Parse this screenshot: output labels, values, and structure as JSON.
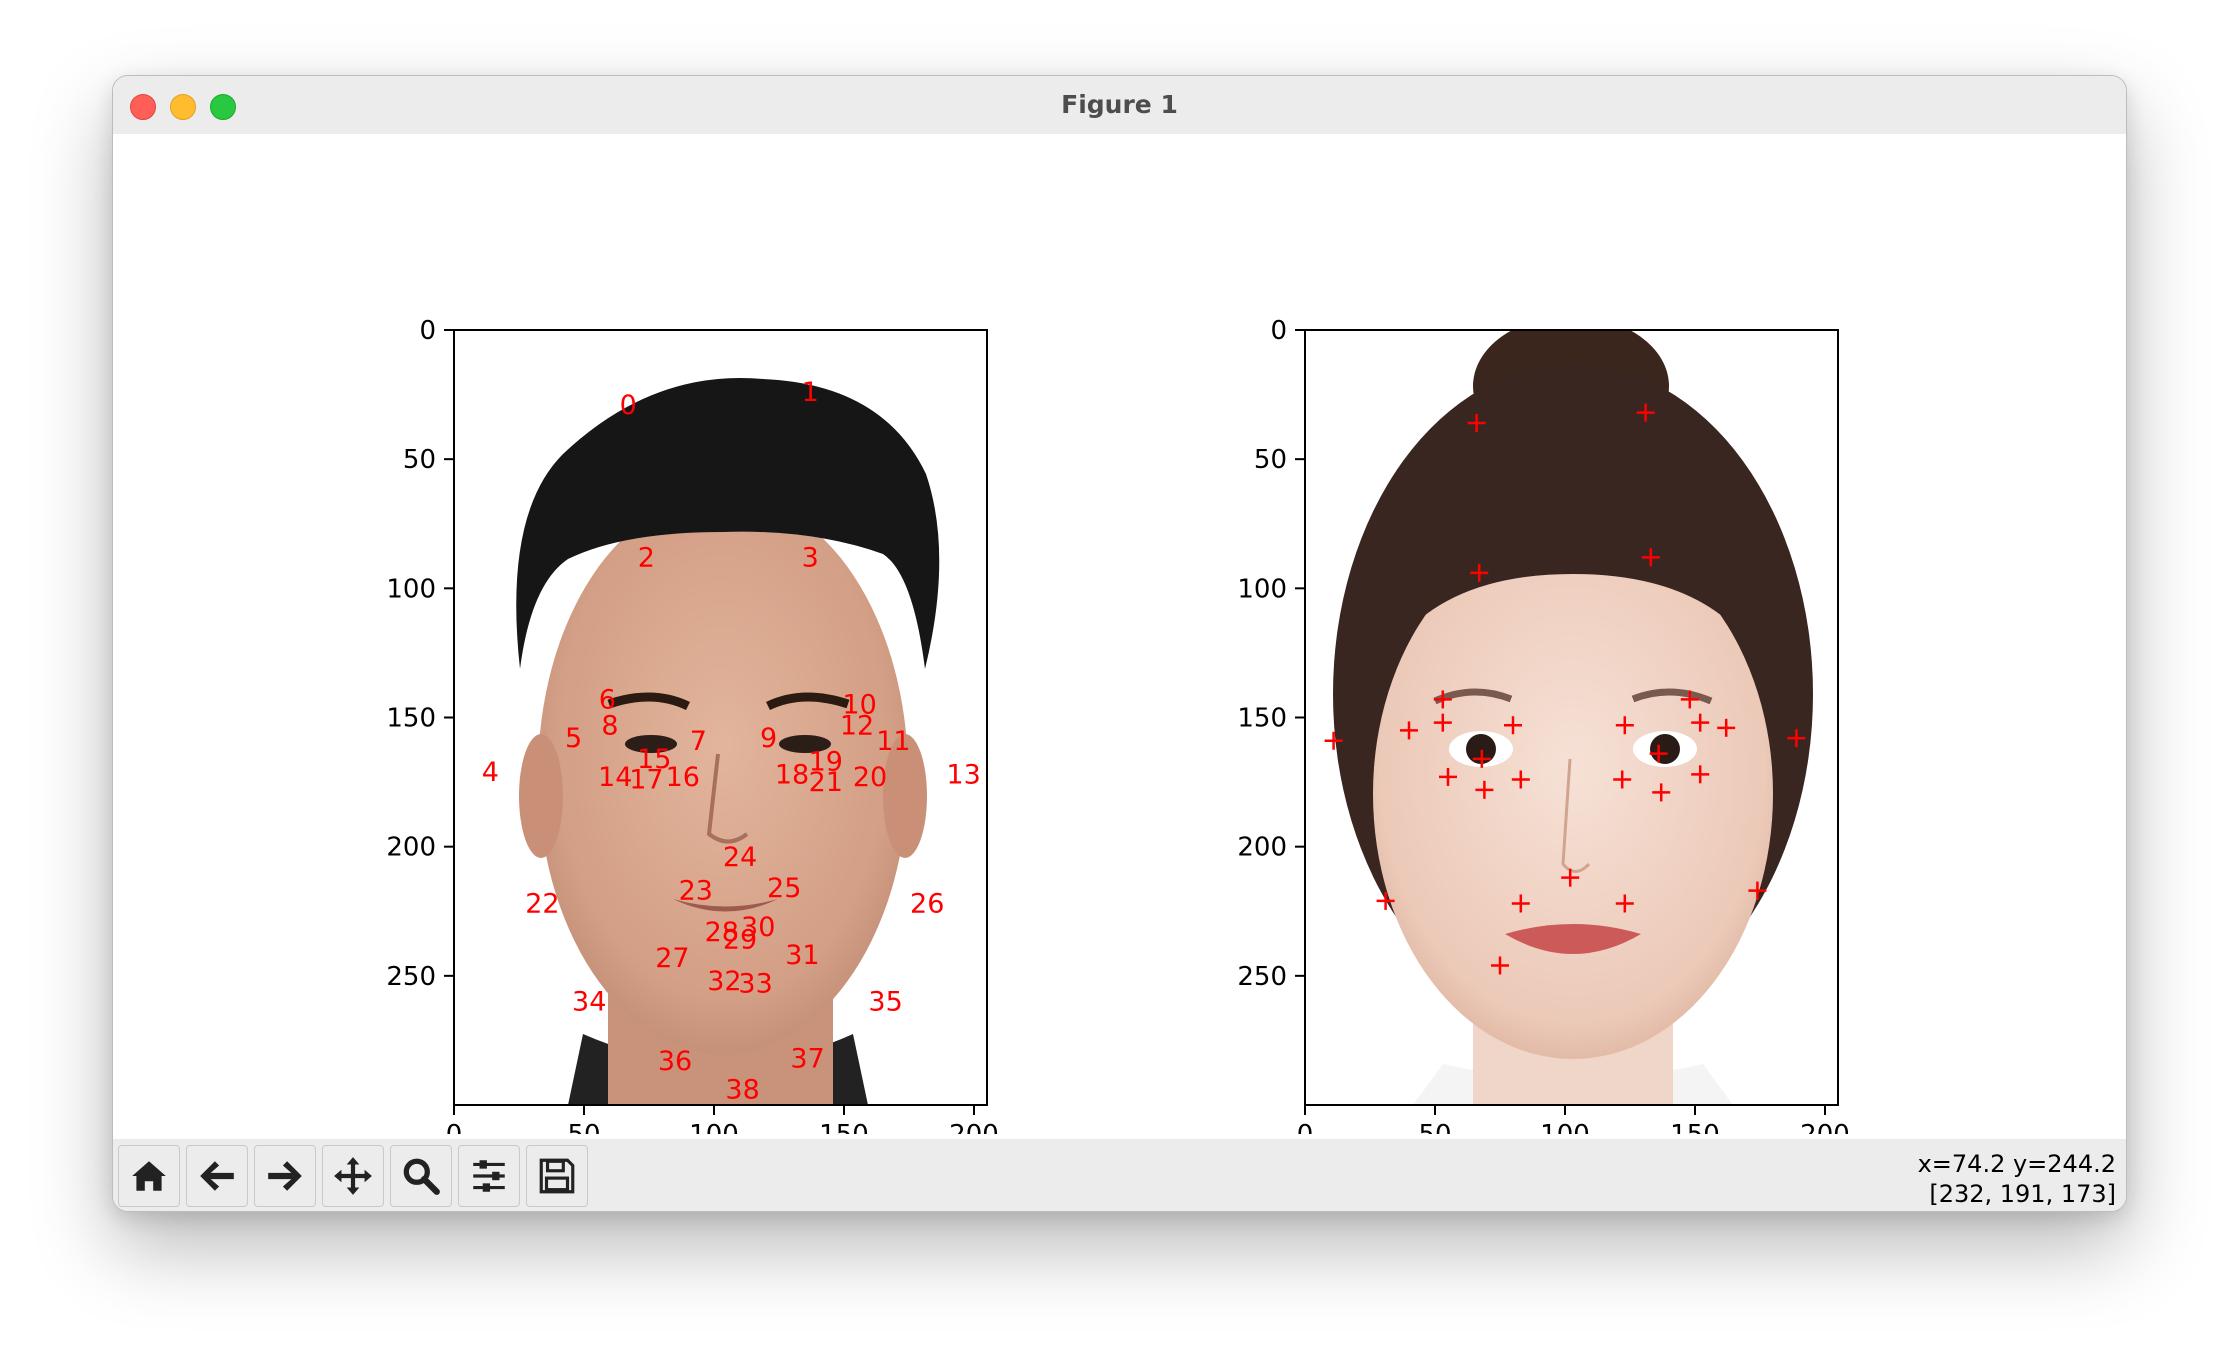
{
  "window": {
    "title": "Figure 1"
  },
  "toolbar": {
    "buttons": [
      {
        "name": "home-button",
        "icon": "home-icon"
      },
      {
        "name": "back-button",
        "icon": "arrow-left-icon"
      },
      {
        "name": "forward-button",
        "icon": "arrow-right-icon"
      },
      {
        "name": "pan-button",
        "icon": "move-icon"
      },
      {
        "name": "zoom-button",
        "icon": "magnifier-icon"
      },
      {
        "name": "configure-subplots-button",
        "icon": "sliders-icon"
      },
      {
        "name": "save-button",
        "icon": "floppy-disk-icon"
      }
    ]
  },
  "status": {
    "coords": "x=74.2 y=244.2",
    "pixel": "[232, 191, 173]"
  },
  "chart_data": [
    {
      "type": "scatter",
      "title": "",
      "xlabel": "",
      "ylabel": "",
      "xlim": [
        0,
        205
      ],
      "ylim": [
        300,
        0
      ],
      "xticks": [
        "0",
        "50",
        "100",
        "150",
        "200"
      ],
      "yticks": [
        "0",
        "50",
        "100",
        "150",
        "200",
        "250"
      ],
      "marker": "text-index",
      "marker_color": "#ff0000",
      "image": "face-photo-man",
      "points": [
        {
          "label": "0",
          "x": 67,
          "y": 29
        },
        {
          "label": "1",
          "x": 137,
          "y": 24
        },
        {
          "label": "2",
          "x": 74,
          "y": 88
        },
        {
          "label": "3",
          "x": 137,
          "y": 88
        },
        {
          "label": "4",
          "x": 14,
          "y": 171
        },
        {
          "label": "5",
          "x": 46,
          "y": 158
        },
        {
          "label": "6",
          "x": 59,
          "y": 143
        },
        {
          "label": "7",
          "x": 94,
          "y": 159
        },
        {
          "label": "8",
          "x": 60,
          "y": 153
        },
        {
          "label": "9",
          "x": 121,
          "y": 158
        },
        {
          "label": "10",
          "x": 156,
          "y": 145
        },
        {
          "label": "11",
          "x": 169,
          "y": 159
        },
        {
          "label": "12",
          "x": 155,
          "y": 153
        },
        {
          "label": "13",
          "x": 196,
          "y": 172
        },
        {
          "label": "14",
          "x": 62,
          "y": 173
        },
        {
          "label": "15",
          "x": 77,
          "y": 166
        },
        {
          "label": "16",
          "x": 88,
          "y": 173
        },
        {
          "label": "17",
          "x": 74,
          "y": 174
        },
        {
          "label": "18",
          "x": 130,
          "y": 172
        },
        {
          "label": "19",
          "x": 143,
          "y": 167
        },
        {
          "label": "20",
          "x": 160,
          "y": 173
        },
        {
          "label": "21",
          "x": 143,
          "y": 175
        },
        {
          "label": "22",
          "x": 34,
          "y": 222
        },
        {
          "label": "23",
          "x": 93,
          "y": 217
        },
        {
          "label": "24",
          "x": 110,
          "y": 204
        },
        {
          "label": "25",
          "x": 127,
          "y": 216
        },
        {
          "label": "26",
          "x": 182,
          "y": 222
        },
        {
          "label": "27",
          "x": 84,
          "y": 243
        },
        {
          "label": "28",
          "x": 103,
          "y": 233
        },
        {
          "label": "29",
          "x": 110,
          "y": 236
        },
        {
          "label": "30",
          "x": 117,
          "y": 231
        },
        {
          "label": "31",
          "x": 134,
          "y": 242
        },
        {
          "label": "32",
          "x": 104,
          "y": 252
        },
        {
          "label": "33",
          "x": 116,
          "y": 253
        },
        {
          "label": "34",
          "x": 52,
          "y": 260
        },
        {
          "label": "35",
          "x": 166,
          "y": 260
        },
        {
          "label": "36",
          "x": 85,
          "y": 283
        },
        {
          "label": "37",
          "x": 136,
          "y": 282
        },
        {
          "label": "38",
          "x": 111,
          "y": 294
        }
      ]
    },
    {
      "type": "scatter",
      "title": "",
      "xlabel": "",
      "ylabel": "",
      "xlim": [
        0,
        205
      ],
      "ylim": [
        300,
        0
      ],
      "xticks": [
        "0",
        "50",
        "100",
        "150",
        "200"
      ],
      "yticks": [
        "0",
        "50",
        "100",
        "150",
        "200",
        "250"
      ],
      "marker": "+",
      "marker_color": "#ff0000",
      "image": "face-photo-woman",
      "points": [
        {
          "x": 66,
          "y": 36
        },
        {
          "x": 131,
          "y": 32
        },
        {
          "x": 67,
          "y": 94
        },
        {
          "x": 133,
          "y": 88
        },
        {
          "x": 11,
          "y": 159
        },
        {
          "x": 40,
          "y": 155
        },
        {
          "x": 53,
          "y": 143
        },
        {
          "x": 80,
          "y": 153
        },
        {
          "x": 53,
          "y": 152
        },
        {
          "x": 123,
          "y": 153
        },
        {
          "x": 148,
          "y": 143
        },
        {
          "x": 162,
          "y": 154
        },
        {
          "x": 152,
          "y": 152
        },
        {
          "x": 189,
          "y": 158
        },
        {
          "x": 55,
          "y": 173
        },
        {
          "x": 68,
          "y": 166
        },
        {
          "x": 83,
          "y": 174
        },
        {
          "x": 69,
          "y": 178
        },
        {
          "x": 122,
          "y": 174
        },
        {
          "x": 136,
          "y": 164
        },
        {
          "x": 152,
          "y": 172
        },
        {
          "x": 137,
          "y": 179
        },
        {
          "x": 31,
          "y": 221
        },
        {
          "x": 83,
          "y": 222
        },
        {
          "x": 102,
          "y": 212
        },
        {
          "x": 123,
          "y": 222
        },
        {
          "x": 174,
          "y": 217
        },
        {
          "x": 75,
          "y": 246
        }
      ]
    }
  ]
}
